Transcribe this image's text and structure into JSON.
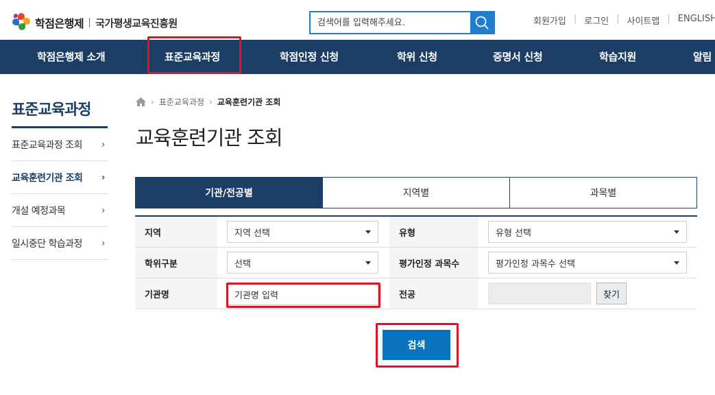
{
  "header": {
    "logo_name": "학점은행제",
    "logo_org": "국가평생교육진흥원",
    "search_placeholder": "검색어를 입력해주세요.",
    "util": [
      "회원가입",
      "로그인",
      "사이트맵",
      "ENGLISH"
    ]
  },
  "gnb": [
    "학점은행제 소개",
    "표준교육과정",
    "학점인정 신청",
    "학위 신청",
    "증명서 신청",
    "학습지원",
    "알림"
  ],
  "lnb": {
    "title": "표준교육과정",
    "items": [
      {
        "label": "표준교육과정 조회",
        "active": false
      },
      {
        "label": "교육훈련기관 조회",
        "active": true
      },
      {
        "label": "개설 예정과목",
        "active": false
      },
      {
        "label": "일시중단 학습과정",
        "active": false
      }
    ]
  },
  "breadcrumb": {
    "parent": "표준교육과정",
    "current": "교육훈련기관 조회"
  },
  "page_title": "교육훈련기관 조회",
  "tabs": [
    {
      "label": "기관/전공별",
      "active": true
    },
    {
      "label": "지역별",
      "active": false
    },
    {
      "label": "과목별",
      "active": false
    }
  ],
  "form": {
    "region_label": "지역",
    "region_value": "지역 선택",
    "type_label": "유형",
    "type_value": "유형 선택",
    "degree_label": "학위구분",
    "degree_value": "선택",
    "credit_label": "평가인정 과목수",
    "credit_value": "평가인정 과목수 선택",
    "inst_label": "기관명",
    "inst_placeholder": "기관명 입력",
    "major_label": "전공",
    "find_button": "찾기"
  },
  "submit_label": "검색",
  "colors": {
    "navy": "#1c3e64",
    "blue": "#0a73c0",
    "highlight": "#e0141e"
  }
}
